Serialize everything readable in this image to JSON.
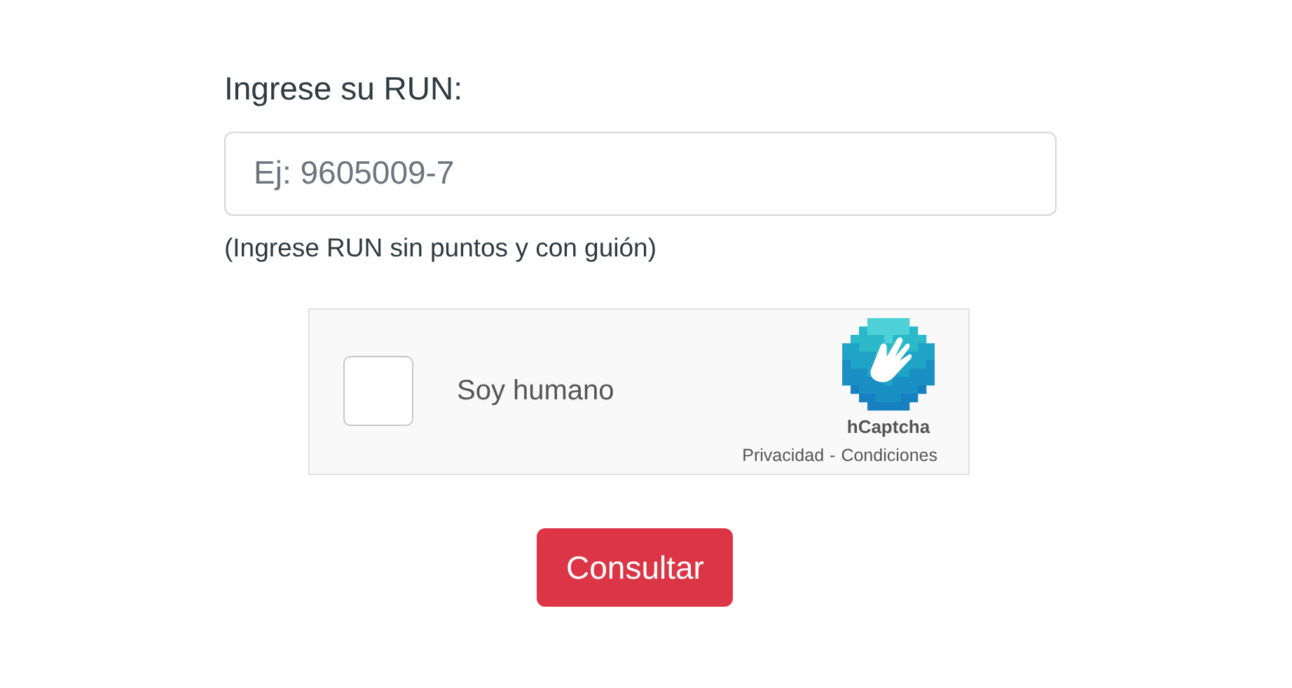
{
  "form": {
    "label": "Ingrese su RUN:",
    "placeholder": "Ej: 9605009-7",
    "hint": "(Ingrese RUN sin puntos y con guión)"
  },
  "captcha": {
    "checked": false,
    "label": "Soy humano",
    "brand": "hCaptcha",
    "links": [
      "Privacidad",
      "Condiciones"
    ],
    "separator": "-"
  },
  "submit": {
    "label": "Consultar"
  }
}
